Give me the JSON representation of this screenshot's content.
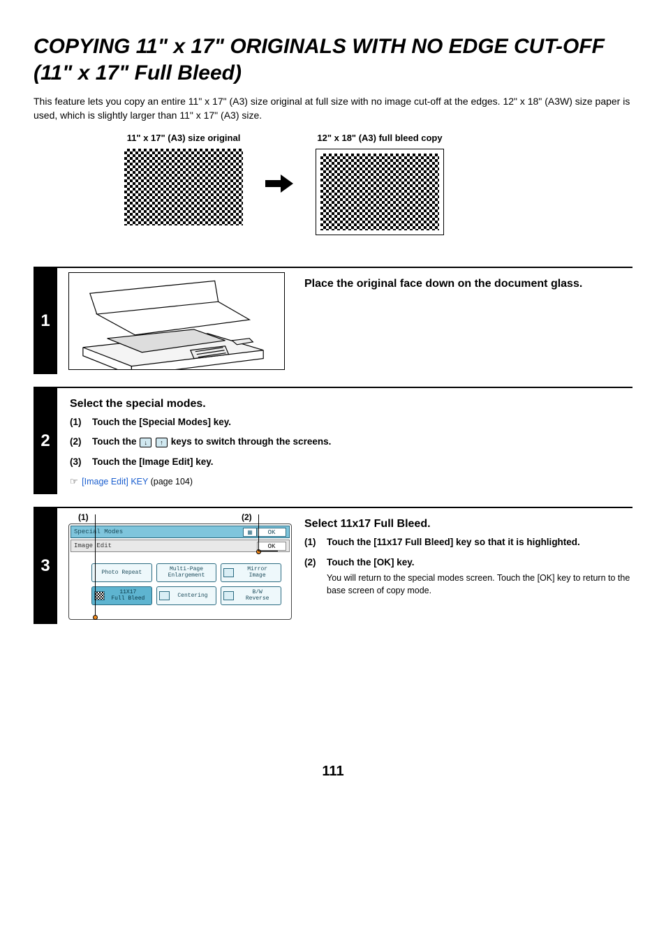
{
  "page_number": "111",
  "title": "COPYING 11\" x 17\" ORIGINALS WITH NO EDGE CUT-OFF (11\" x 17\" Full Bleed)",
  "intro": "This feature lets you copy an entire 11\" x 17\" (A3) size original at full size with no image cut-off at the edges. 12\" x 18\" (A3W) size paper is used, which is slightly larger than 11\" x 17\" (A3) size.",
  "diagram": {
    "left_caption": "11\" x 17\" (A3) size original",
    "right_caption": "12\" x 18\" (A3) full bleed copy"
  },
  "steps": {
    "s1": {
      "num": "1",
      "title": "Place the original face down on the document glass."
    },
    "s2": {
      "num": "2",
      "title": "Select the special modes.",
      "items": [
        {
          "n": "(1)",
          "text": "Touch the [Special Modes] key."
        },
        {
          "n": "(2)",
          "text_before": "Touch the ",
          "text_after": " keys to switch through the screens."
        },
        {
          "n": "(3)",
          "text": "Touch the [Image Edit] key."
        }
      ],
      "ref_link": "[Image Edit] KEY",
      "ref_after": " (page 104)"
    },
    "s3": {
      "num": "3",
      "title": "Select 11x17 Full Bleed.",
      "items": [
        {
          "n": "(1)",
          "text": "Touch the [11x17 Full Bleed] key so that it is highlighted."
        },
        {
          "n": "(2)",
          "text": "Touch the [OK] key.",
          "desc": "You will return to the special modes screen. Touch the [OK] key to return to the base screen of copy mode."
        }
      ],
      "callouts": {
        "c1": "(1)",
        "c2": "(2)"
      },
      "panel": {
        "hdr1_label": "Special Modes",
        "hdr1_ok": "OK",
        "hdr2_label": "Image Edit",
        "hdr2_ok": "OK",
        "buttons": [
          {
            "label": "Photo Repeat"
          },
          {
            "label": "Multi-Page\nEnlargement"
          },
          {
            "label": "Mirror\nImage"
          },
          {
            "label": "11X17\nFull Bleed",
            "selected": true
          },
          {
            "label": "Centering"
          },
          {
            "label": "B/W\nReverse"
          }
        ]
      }
    }
  }
}
